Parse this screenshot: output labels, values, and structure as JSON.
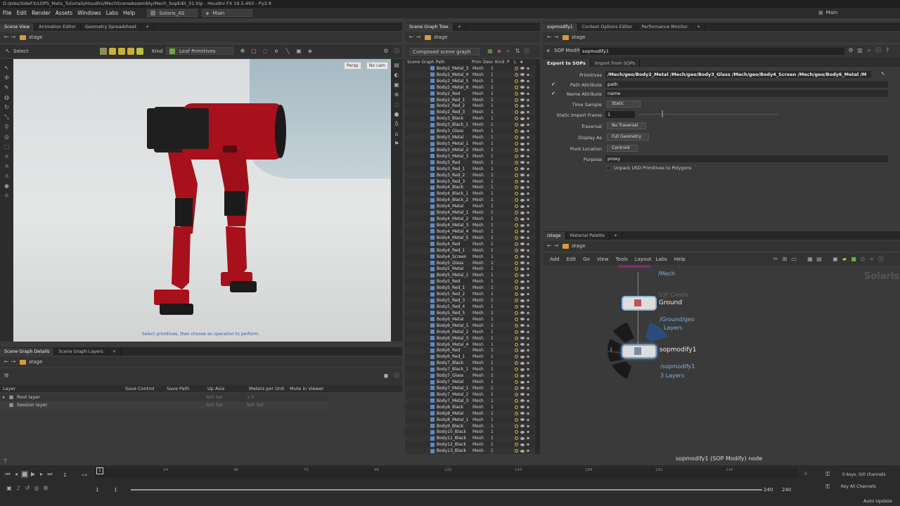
{
  "window": {
    "title": "D:/Jobs/SideFX/LOPS_Matx_Tutorials/Houdini/MechSceneAssembly/Mech_SopEdit_01.hip - Houdini FX 19.5.493 - Py3.9",
    "workspace": "Main"
  },
  "menu": {
    "items": [
      "File",
      "Edit",
      "Render",
      "Assets",
      "Windows",
      "Labs",
      "Help"
    ],
    "desktop": "Solaris_AS",
    "context": "Main"
  },
  "left_pane": {
    "tabs": [
      "Scene View",
      "Animation Editor",
      "Geometry Spreadsheet"
    ],
    "path": "stage",
    "tool": "Select",
    "kind_label": "Kind",
    "kind_value": "Leaf Primitives",
    "camera_persp": "Persp",
    "camera_nocam": "No cam",
    "hint": "Select primitives, then choose an operation to perform."
  },
  "bottom_left": {
    "tabs": [
      "Scene Graph Details",
      "Scene Graph Layers"
    ],
    "path": "stage",
    "headers": [
      "Layer",
      "Save Control",
      "Save Path",
      "Up Axis",
      "Meters per Unit",
      "Mute in Viewer"
    ],
    "rows": [
      {
        "name": "Root layer",
        "up": "Not Set",
        "mpu": "1.0"
      },
      {
        "name": "Session layer",
        "up": "Not Set",
        "mpu": "Not Set"
      }
    ]
  },
  "tree_pane": {
    "tab": "Scene Graph Tree",
    "path": "stage",
    "filter": "Composed scene graph",
    "headers": [
      "Scene Graph Path",
      "Prim",
      "Desc",
      "Kind",
      "P",
      "L"
    ],
    "type": "Mesh",
    "desc": "1",
    "rows": [
      "Body2_Metal_3",
      "Body2_Metal_4",
      "Body2_Metal_5",
      "Body2_Metal_6",
      "Body2_Red",
      "Body2_Red_1",
      "Body2_Red_2",
      "Body2_Red_3",
      "Body3_Black",
      "Body3_Black_1",
      "Body3_Glass",
      "Body3_Metal",
      "Body3_Metal_1",
      "Body3_Metal_2",
      "Body3_Metal_3",
      "Body3_Red",
      "Body3_Red_1",
      "Body3_Red_2",
      "Body3_Red_3",
      "Body4_Black",
      "Body4_Black_1",
      "Body4_Black_2",
      "Body4_Metal",
      "Body4_Metal_1",
      "Body4_Metal_2",
      "Body4_Metal_3",
      "Body4_Metal_4",
      "Body4_Metal_5",
      "Body4_Red",
      "Body4_Red_1",
      "Body4_Screen",
      "Body5_Glass",
      "Body5_Metal",
      "Body5_Metal_1",
      "Body5_Red",
      "Body5_Red_1",
      "Body5_Red_2",
      "Body5_Red_3",
      "Body5_Red_4",
      "Body5_Red_5",
      "Body6_Metal",
      "Body6_Metal_1",
      "Body6_Metal_2",
      "Body6_Metal_3",
      "Body6_Metal_4",
      "Body6_Red",
      "Body6_Red_1",
      "Body7_Black",
      "Body7_Black_1",
      "Body7_Glass",
      "Body7_Metal",
      "Body7_Metal_1",
      "Body7_Metal_2",
      "Body7_Metal_3",
      "Body8_Black",
      "Body8_Metal",
      "Body8_Metal_1",
      "Body9_Black",
      "Body10_Black",
      "Body11_Black",
      "Body12_Black",
      "Body13_Black"
    ]
  },
  "params": {
    "tabs": [
      "sopmodify1",
      "Context Options Editor",
      "Performance Monitor"
    ],
    "path": "stage",
    "node_type": "SOP Modify",
    "node_name": "sopmodify1",
    "sub_tabs": [
      "Export to SOPs",
      "Import from SOPs"
    ],
    "primitives_label": "Primitives",
    "primitives_value": "/Mech/geo/Body2_Metal /Mech/geo/Body3_Glass /Mech/geo/Body4_Screen /Mech/geo/Body6_Metal /M",
    "path_attr_label": "Path Attribute",
    "path_attr": "path",
    "name_attr_label": "Name Attribute",
    "name_attr": "name",
    "time_sample_label": "Time Sample",
    "time_sample": "Static",
    "static_frame_label": "Static Import Frame",
    "static_frame": "1",
    "traversal_label": "Traversal",
    "traversal": "No Traversal",
    "display_as_label": "Display As",
    "display_as": "Full Geometry",
    "pivot_label": "Pivot Location",
    "pivot": "Centroid",
    "purpose_label": "Purpose",
    "purpose": "proxy",
    "unpack_label": "Unpack USD Primitives to Polygons"
  },
  "network": {
    "tabs": [
      "/stage",
      "Material Palette"
    ],
    "path": "stage",
    "menu": [
      "Add",
      "Edit",
      "Go",
      "View",
      "Tools",
      "Layout",
      "Labs",
      "Help"
    ],
    "watermark": "Solaris",
    "mech_label": "/Mech",
    "ground_type": "SOP Create",
    "ground_name": "Ground",
    "ground_path": "/Ground/geo",
    "ground_layers": "Layers",
    "sop_name": "sopmodify1",
    "sop_path": "/sopmodify1",
    "sop_layers": "3 Layers",
    "status": "sopmodify1 (SOP Modify) node"
  },
  "timeline": {
    "ticks": [
      "24",
      "48",
      "72",
      "96",
      "120",
      "144",
      "168",
      "192",
      "216"
    ],
    "frame": "1",
    "start": "1",
    "start2": "1",
    "end": "240",
    "end2": "240",
    "keys": "0 keys, 0/0 channels",
    "key_all": "Key All Channels",
    "auto_update": "Auto Update"
  }
}
